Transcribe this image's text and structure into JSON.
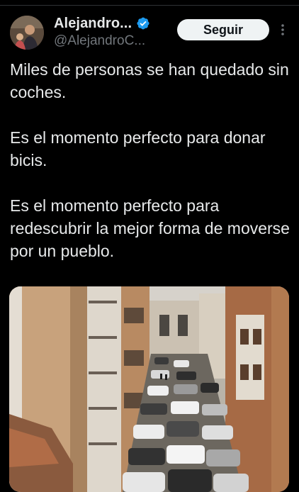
{
  "author": {
    "display_name": "Alejandro...",
    "handle": "@AlejandroC...",
    "verified": true,
    "avatar_icon": "user-avatar"
  },
  "actions": {
    "follow_label": "Seguir",
    "more_icon": "more-vertical-icon"
  },
  "tweet": {
    "paragraphs": [
      "Miles de personas se han quedado sin coches.",
      "Es el momento perfecto para donar bicis.",
      "Es el momento perfecto para redescubrir la mejor forma de moverse por un pueblo."
    ]
  },
  "media": {
    "description_icon": "photo-flooded-street-with-piled-cars"
  },
  "colors": {
    "background": "#000000",
    "text_primary": "#e7e9ea",
    "text_secondary": "#71767b",
    "verified_blue": "#1d9bf0",
    "button_bg": "#eff3f4",
    "button_text": "#0f1419"
  }
}
